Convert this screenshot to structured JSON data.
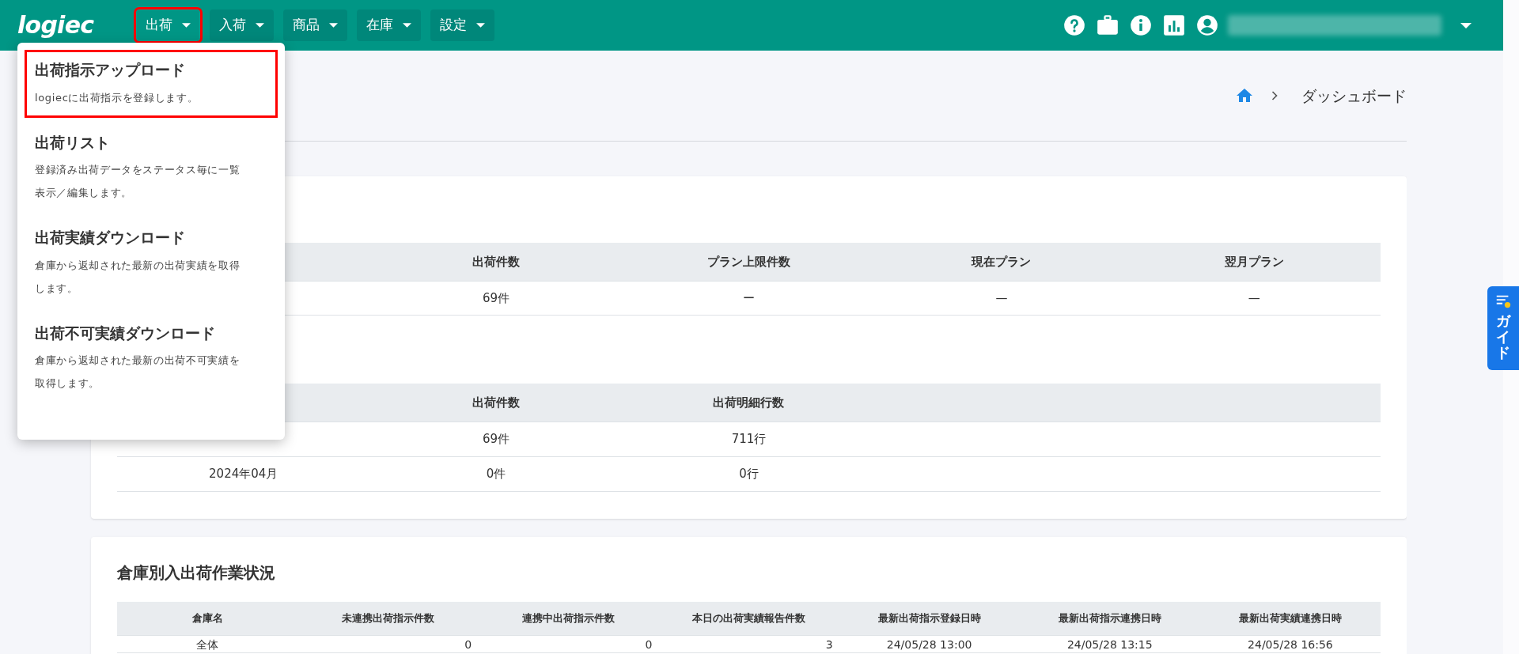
{
  "header": {
    "logo": "logiec",
    "nav": [
      {
        "label": "出荷",
        "highlighted": true,
        "open": true
      },
      {
        "label": "入荷",
        "highlighted": false,
        "open": false
      },
      {
        "label": "商品",
        "highlighted": false,
        "open": false
      },
      {
        "label": "在庫",
        "highlighted": false,
        "open": false
      },
      {
        "label": "設定",
        "highlighted": false,
        "open": false
      }
    ]
  },
  "menu": [
    {
      "title": "出荷指示アップロード",
      "description": "logiecに出荷指示を登録します。",
      "highlighted": true
    },
    {
      "title": "出荷リスト",
      "description": "登録済み出荷データをステータス毎に一覧表示／編集します。",
      "highlighted": false
    },
    {
      "title": "出荷実績ダウンロード",
      "description": "倉庫から返却された最新の出荷実績を取得します。",
      "highlighted": false
    },
    {
      "title": "出荷不可実績ダウンロード",
      "description": "倉庫から返却された最新の出荷不可実績を取得します。",
      "highlighted": false
    }
  ],
  "breadcrumb": [
    "ダッシュボード"
  ],
  "plan_table": {
    "columns": [
      "出荷件数",
      "プラン上限件数",
      "現在プラン",
      "翌月プラン"
    ],
    "rows": [
      [
        "69件",
        "ー",
        "—",
        "—"
      ]
    ]
  },
  "monthly_table": {
    "columns": [
      "出荷件数",
      "出荷明細行数"
    ],
    "rows": [
      {
        "cells": [
          "69件",
          "711行"
        ]
      },
      {
        "month": "2024年04月",
        "cells": [
          "0件",
          "0行"
        ]
      }
    ]
  },
  "warehouse": {
    "title": "倉庫別入出荷作業状況",
    "columns": [
      "倉庫名",
      "未連携出荷指示件数",
      "連携中出荷指示件数",
      "本日の出荷実績報告件数",
      "最新出荷指示登録日時",
      "最新出荷指示連携日時",
      "最新出荷実績連携日時"
    ],
    "rows": [
      [
        "全体",
        "0",
        "0",
        "3",
        "24/05/28 13:00",
        "24/05/28 13:15",
        "24/05/28 16:56"
      ]
    ]
  },
  "guide": {
    "label": "ガイド"
  }
}
